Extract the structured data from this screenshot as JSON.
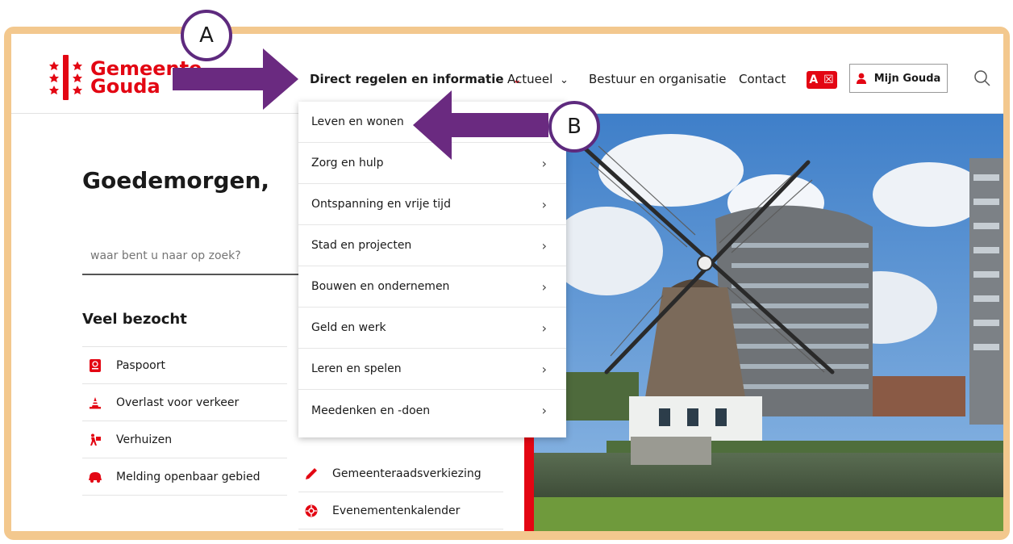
{
  "logo": {
    "line1": "Gemeente",
    "line2": "Gouda"
  },
  "nav": {
    "direct": "Direct regelen en informatie",
    "actueel": "Actueel",
    "bestuur": "Bestuur en organisatie",
    "contact": "Contact",
    "az": "A ☒",
    "mijn": "Mijn Gouda"
  },
  "hero": {
    "greeting": "Goedemorgen,",
    "search_placeholder": "waar bent u naar op zoek?"
  },
  "veel": {
    "title": "Veel bezocht",
    "left": [
      {
        "label": "Paspoort",
        "icon": "passport-icon"
      },
      {
        "label": "Overlast voor verkeer",
        "icon": "traffic-cone-icon"
      },
      {
        "label": "Verhuizen",
        "icon": "moving-person-icon"
      },
      {
        "label": "Melding openbaar gebied",
        "icon": "megaphone-icon"
      }
    ],
    "right": [
      {
        "label": "Gemeenteraadsverkiezing",
        "icon": "pencil-icon"
      },
      {
        "label": "Evenementenkalender",
        "icon": "event-icon"
      }
    ]
  },
  "dropdown": [
    {
      "label": "Leven en wonen"
    },
    {
      "label": "Zorg en hulp"
    },
    {
      "label": "Ontspanning en vrije tijd"
    },
    {
      "label": "Stad en projecten"
    },
    {
      "label": "Bouwen en ondernemen"
    },
    {
      "label": "Geld en werk"
    },
    {
      "label": "Leren en spelen"
    },
    {
      "label": "Meedenken en -doen"
    }
  ],
  "callouts": {
    "a": "A",
    "b": "B"
  },
  "colors": {
    "brand": "#e30613",
    "frame": "#f3c88e",
    "arrow": "#6a2a80"
  }
}
